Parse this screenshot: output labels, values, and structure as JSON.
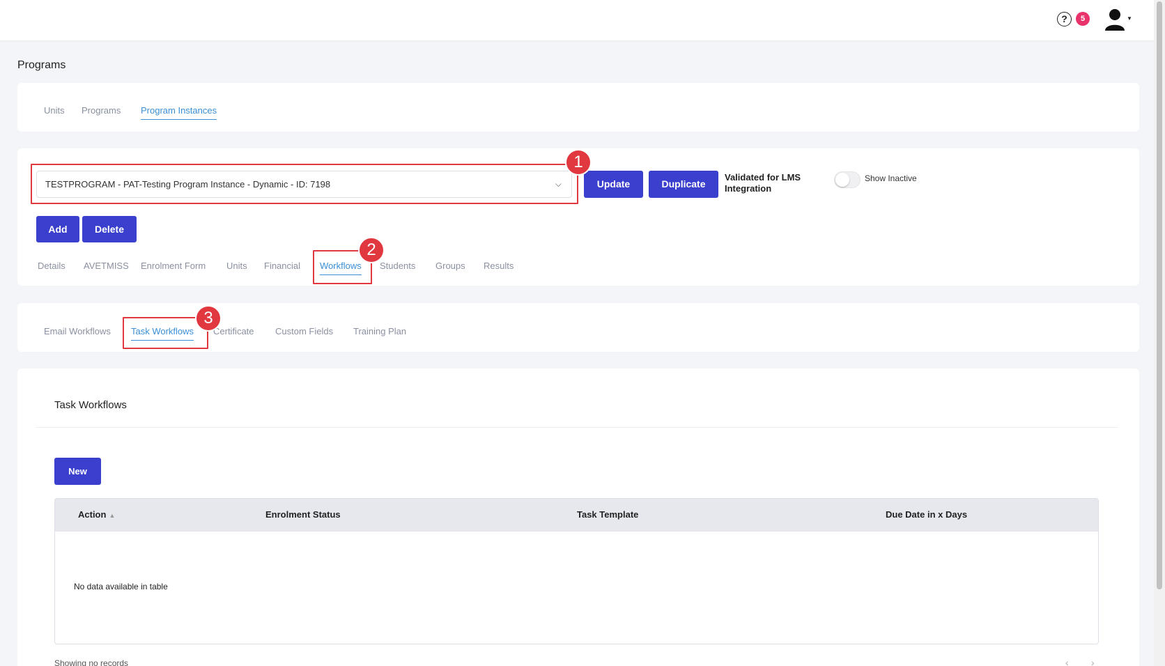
{
  "header": {
    "help_glyph": "?",
    "notification_count": "5"
  },
  "page": {
    "title": "Programs"
  },
  "top_tabs": [
    {
      "label": "Units"
    },
    {
      "label": "Programs"
    },
    {
      "label": "Program Instances",
      "active": true
    }
  ],
  "instance": {
    "selected": "TESTPROGRAM - PAT-Testing Program Instance - Dynamic - ID: 7198",
    "update_label": "Update",
    "duplicate_label": "Duplicate",
    "lms_label": "Validated for LMS Integration",
    "show_inactive_label": "Show Inactive",
    "show_inactive_on": false,
    "add_label": "Add",
    "delete_label": "Delete"
  },
  "instance_tabs": [
    {
      "label": "Details"
    },
    {
      "label": "AVETMISS"
    },
    {
      "label": "Enrolment Form"
    },
    {
      "label": "Units"
    },
    {
      "label": "Financial"
    },
    {
      "label": "Workflows",
      "active": true
    },
    {
      "label": "Students"
    },
    {
      "label": "Groups"
    },
    {
      "label": "Results"
    }
  ],
  "workflow_tabs": [
    {
      "label": "Email Workflows"
    },
    {
      "label": "Task Workflows",
      "active": true
    },
    {
      "label": "Certificate"
    },
    {
      "label": "Custom Fields"
    },
    {
      "label": "Training Plan"
    }
  ],
  "annotations": [
    "1",
    "2",
    "3"
  ],
  "task_workflows": {
    "title": "Task Workflows",
    "new_label": "New",
    "columns": [
      "Action",
      "Enrolment Status",
      "Task Template",
      "Due Date in x Days"
    ],
    "empty_message": "No data available in table",
    "footer": "Showing no records",
    "pager_prev": "‹",
    "pager_next": "›"
  },
  "colors": {
    "primary_button": "#3a3fce",
    "active_tab": "#3b8fd6",
    "annotation": "#e0383e",
    "badge": "#e8336b"
  }
}
